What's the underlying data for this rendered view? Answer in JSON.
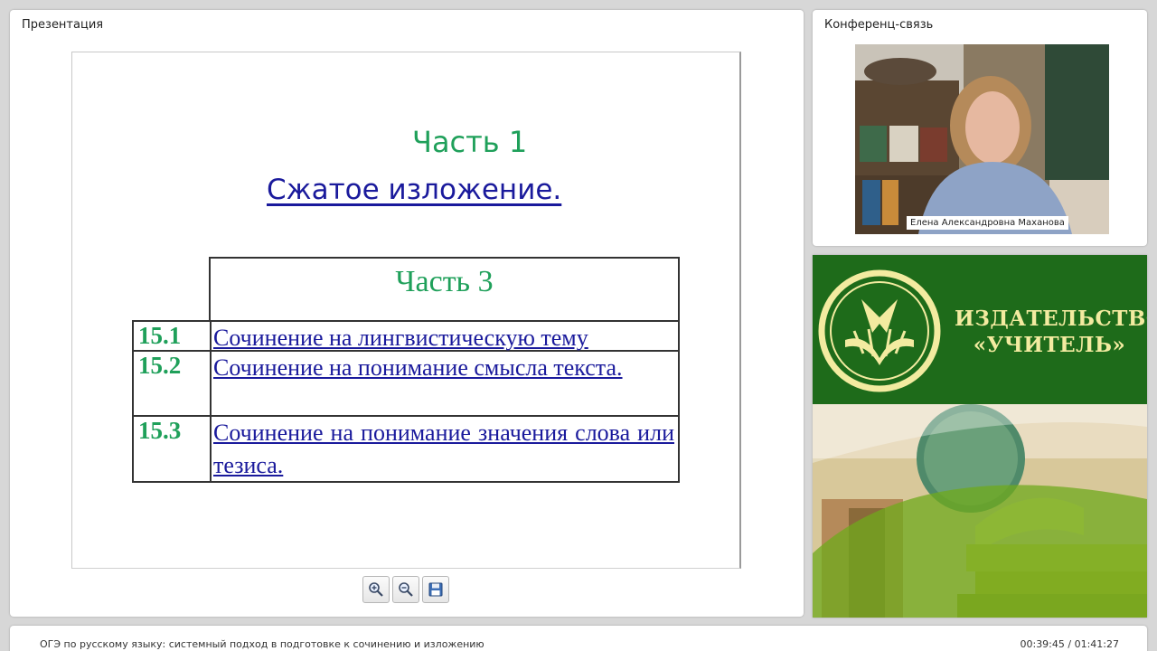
{
  "presentation": {
    "title": "Презентация",
    "slide": {
      "part1": "Часть 1",
      "subtitle": "Сжатое изложение.",
      "table": {
        "header": "Часть 3",
        "rows": [
          {
            "num": "15.1",
            "text": "Сочинение на лингвистическую тему"
          },
          {
            "num": "15.2",
            "text": "Сочинение на понимание смысла текста."
          },
          {
            "num": "15.3",
            "text": "Сочинение на понимание значения слова или тезиса."
          }
        ]
      }
    },
    "toolbar": {
      "zoom_in_icon": "zoom-in-icon",
      "zoom_out_icon": "zoom-out-icon",
      "save_icon": "floppy-disk-icon"
    }
  },
  "conference": {
    "title": "Конференц-связь",
    "speaker_name": "Елена Александровна Маханова"
  },
  "logo": {
    "line1": "ИЗДАТЕЛЬСТВО",
    "line2": "«УЧИТЕЛЬ»"
  },
  "footer": {
    "title": "ОГЭ по русскому языку: системный подход в подготовке к сочинению и изложению",
    "time": "00:39:45 / 01:41:27"
  },
  "colors": {
    "accent_green": "#1fa05a",
    "link_blue": "#1a1a9c",
    "brand_green": "#1e6b1a",
    "brand_gold": "#f3eba0"
  }
}
